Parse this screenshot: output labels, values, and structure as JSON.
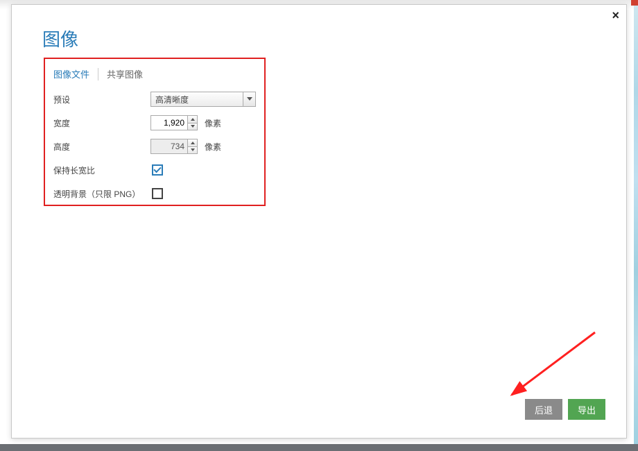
{
  "dialog": {
    "title": "图像",
    "close_label": "×"
  },
  "tabs": {
    "file": "图像文件",
    "share": "共享图像"
  },
  "form": {
    "preset_label": "预设",
    "preset_value": "高清晰度",
    "width_label": "宽度",
    "width_value": "1,920",
    "width_unit": "像素",
    "height_label": "高度",
    "height_value": "734",
    "height_unit": "像素",
    "aspect_label": "保持长宽比",
    "aspect_checked": true,
    "transparent_label": "透明背景（只限 PNG）",
    "transparent_checked": false
  },
  "footer": {
    "back_label": "后退",
    "export_label": "导出"
  },
  "colors": {
    "accent_blue": "#2a7cb8",
    "highlight_red": "#e02020",
    "export_green": "#52a552",
    "back_gray": "#8a8a8a"
  }
}
